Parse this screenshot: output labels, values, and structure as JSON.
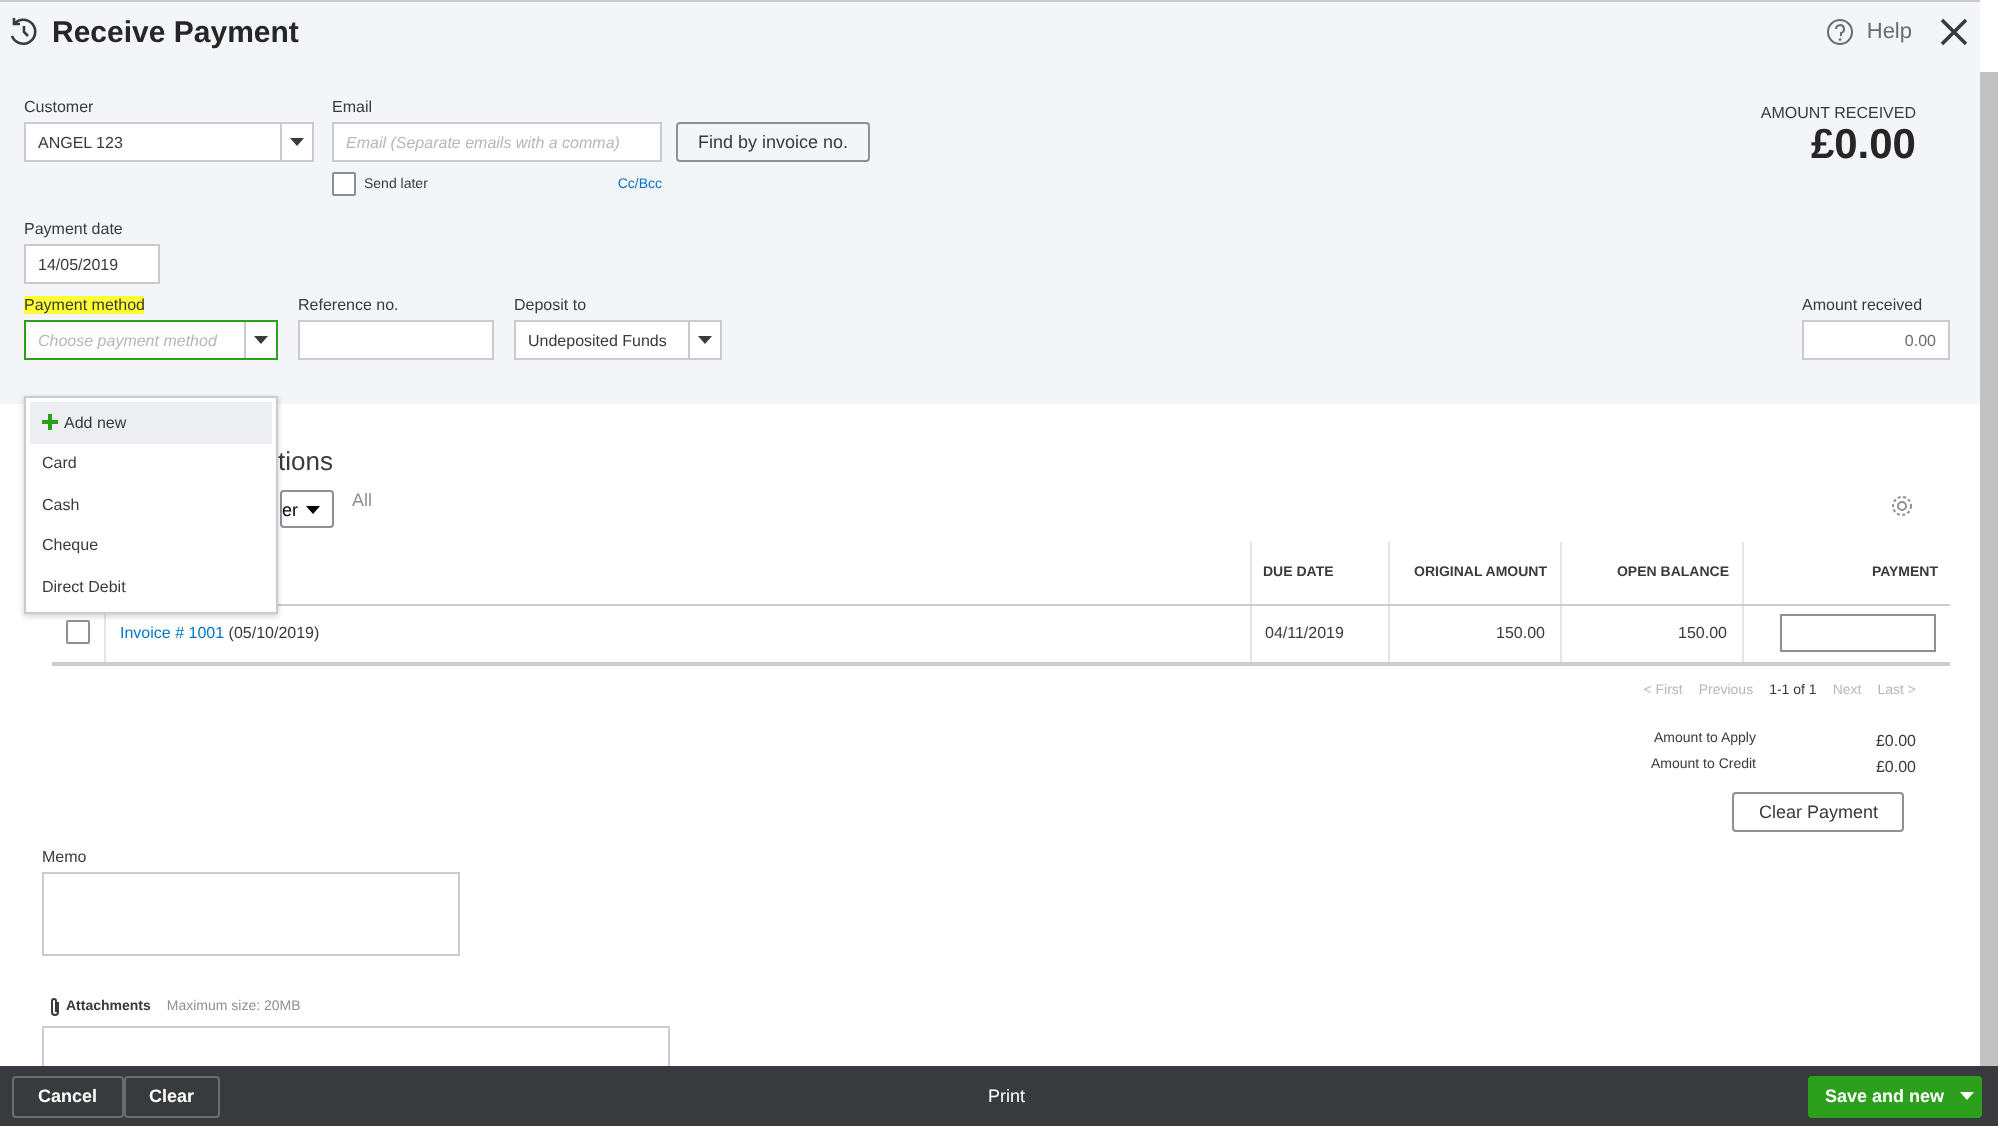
{
  "header": {
    "title": "Receive Payment",
    "help": "Help"
  },
  "customer": {
    "label": "Customer",
    "value": "ANGEL 123"
  },
  "email": {
    "label": "Email",
    "placeholder": "Email (Separate emails with a comma)",
    "send_later": {
      "label": "Send later",
      "checked": false
    },
    "cc_bcc": "Cc/Bcc"
  },
  "find_button": "Find by invoice no.",
  "amount_summary": {
    "label": "AMOUNT RECEIVED",
    "value": "£0.00"
  },
  "payment_date": {
    "label": "Payment date",
    "value": "14/05/2019"
  },
  "payment_method": {
    "label": "Payment method",
    "highlighted": true,
    "placeholder": "Choose payment method",
    "expanded": true,
    "options": [
      {
        "label": "Add new",
        "kind": "add",
        "selected": true
      },
      {
        "label": "Card",
        "kind": "option",
        "selected": false
      },
      {
        "label": "Cash",
        "kind": "option",
        "selected": false
      },
      {
        "label": "Cheque",
        "kind": "option",
        "selected": false
      },
      {
        "label": "Direct Debit",
        "kind": "option",
        "selected": false
      }
    ]
  },
  "reference": {
    "label": "Reference no."
  },
  "deposit_to": {
    "label": "Deposit to",
    "value": "Undeposited Funds"
  },
  "amount_received": {
    "label": "Amount received",
    "value": "0.00"
  },
  "transactions": {
    "heading": "tions",
    "filter": "er",
    "all": "All",
    "columns": [
      "DUE DATE",
      "ORIGINAL AMOUNT",
      "OPEN BALANCE",
      "PAYMENT"
    ],
    "rows": [
      {
        "invoice": "Invoice # 1001",
        "date": "(05/10/2019)",
        "due_date": "04/11/2019",
        "original_amount": "150.00",
        "open_balance": "150.00",
        "checked": false
      }
    ]
  },
  "pagination": [
    {
      "label": "< First",
      "disabled": true
    },
    {
      "label": "Previous",
      "disabled": true
    },
    {
      "label": "1-1 of 1",
      "disabled": false
    },
    {
      "label": "Next",
      "disabled": true
    },
    {
      "label": "Last >",
      "disabled": true
    }
  ],
  "totals": [
    {
      "label": "Amount to Apply",
      "value": "£0.00"
    },
    {
      "label": "Amount to Credit",
      "value": "£0.00"
    }
  ],
  "clear_payment": "Clear Payment",
  "memo": {
    "label": "Memo"
  },
  "attachments": {
    "label": "Attachments",
    "note": "Maximum size: 20MB"
  },
  "footer": {
    "cancel": "Cancel",
    "clear": "Clear",
    "print": "Print",
    "save": "Save and new"
  }
}
